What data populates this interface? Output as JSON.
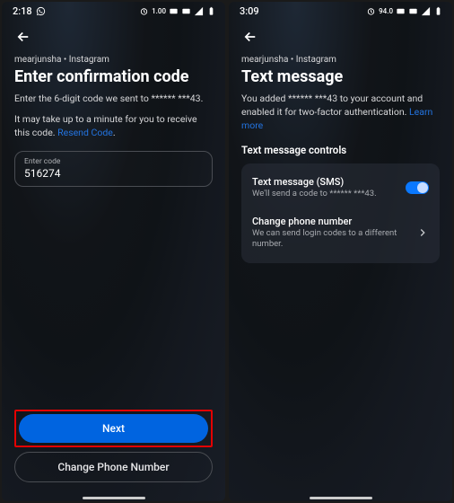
{
  "left": {
    "status": {
      "time": "2:18",
      "battery_label": "1.00"
    },
    "breadcrumb": "mearjunsha • Instagram",
    "title": "Enter confirmation code",
    "instruction": "Enter the 6-digit code we sent to ****** ***43.",
    "delay_prefix": "It may take up to a minute for you to receive this code. ",
    "resend": "Resend Code",
    "delay_suffix": ".",
    "code_label": "Enter code",
    "code_value": "516274",
    "next_label": "Next",
    "change_label": "Change Phone Number"
  },
  "right": {
    "status": {
      "time": "3:09",
      "battery_label": "94.0"
    },
    "breadcrumb": "mearjunsha • Instagram",
    "title": "Text message",
    "added_prefix": "You added ****** ***43 to your account and enabled it for two-factor authentication. ",
    "learn_more": "Learn more",
    "section": "Text message controls",
    "sms_title": "Text message (SMS)",
    "sms_sub": "We'll send a code to ****** ***43.",
    "change_title": "Change phone number",
    "change_sub": "We can send login codes to a different number."
  }
}
